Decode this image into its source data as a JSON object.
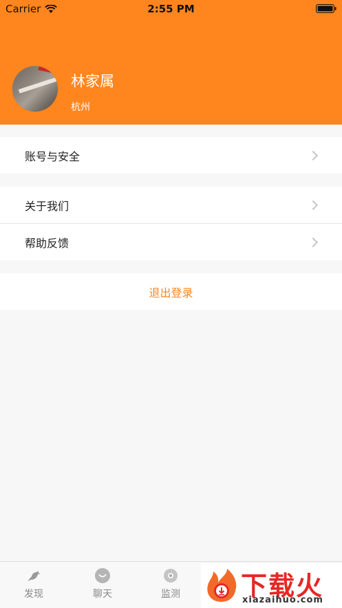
{
  "status_bar": {
    "carrier": "Carrier",
    "time": "2:55 PM"
  },
  "profile": {
    "name": "林家属",
    "city": "杭州"
  },
  "menu": {
    "account_security": "账号与安全",
    "about_us": "关于我们",
    "help_feedback": "帮助反馈",
    "logout": "退出登录"
  },
  "tabbar": {
    "tabs": [
      {
        "label": "发现",
        "icon": "bird-icon"
      },
      {
        "label": "聊天",
        "icon": "chat-icon"
      },
      {
        "label": "监测",
        "icon": "monitor-icon"
      }
    ]
  },
  "watermark": {
    "title": "下载火",
    "subtitle": "xiazaihuo.com"
  },
  "colors": {
    "accent": "#ff861e",
    "background": "#f7f7f7",
    "watermark_red": "#e52826"
  }
}
